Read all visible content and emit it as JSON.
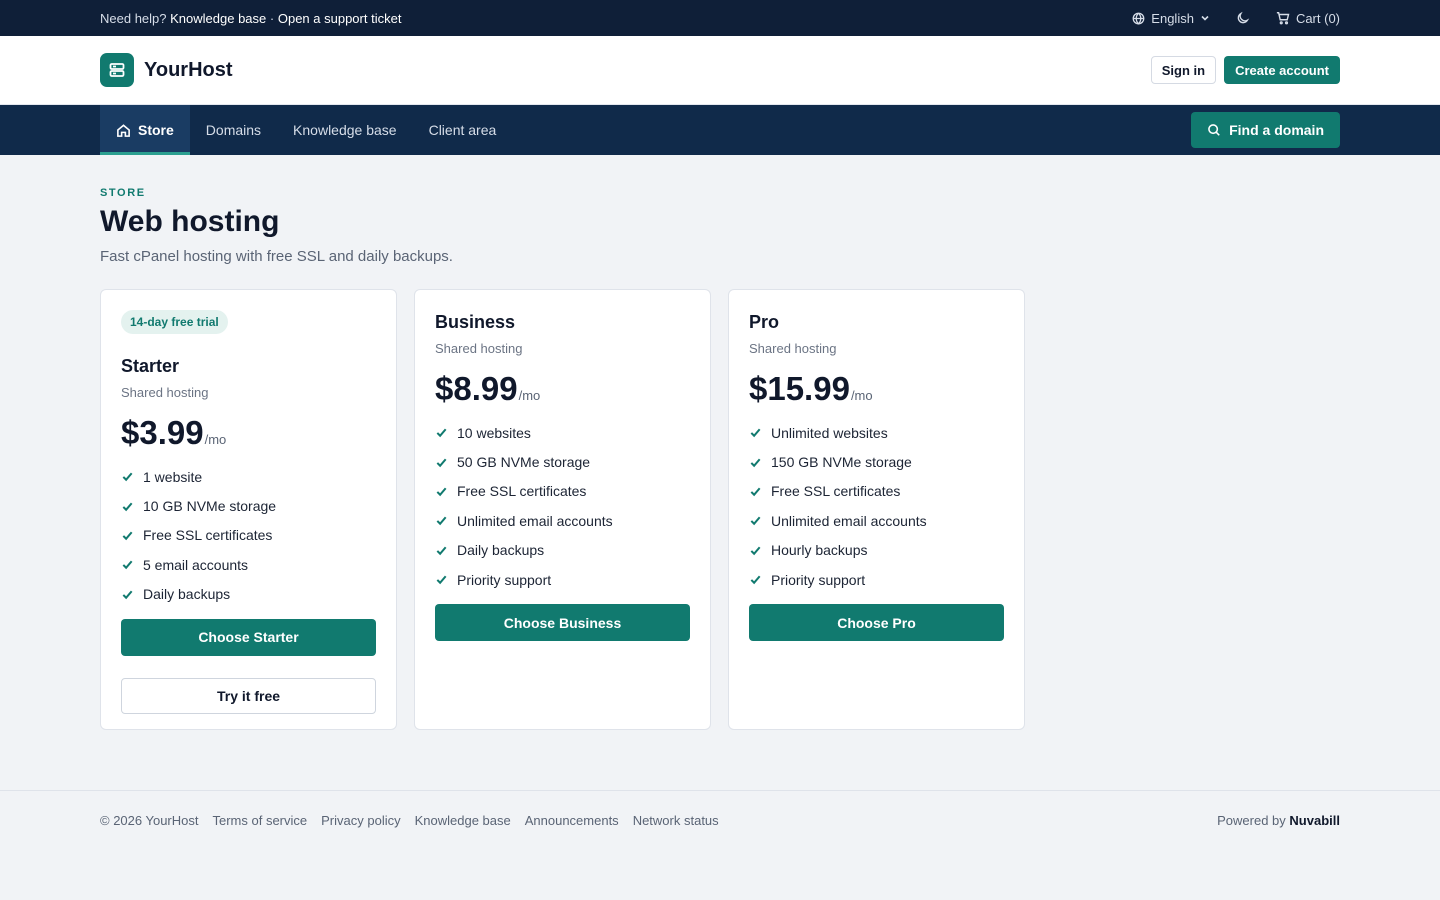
{
  "topbar": {
    "help_prefix": "Need help?",
    "kb_link": "Knowledge base",
    "separator": "·",
    "ticket_link": "Open a support ticket",
    "language": "English",
    "cart": "Cart (0)"
  },
  "header": {
    "brand": "YourHost",
    "sign_in": "Sign in",
    "create_account": "Create account"
  },
  "nav": {
    "items": [
      {
        "label": "Store",
        "active": true
      },
      {
        "label": "Domains"
      },
      {
        "label": "Knowledge base"
      },
      {
        "label": "Client area"
      }
    ],
    "find_domain": "Find a domain"
  },
  "page": {
    "eyebrow": "STORE",
    "title": "Web hosting",
    "subtitle": "Fast cPanel hosting with free SSL and daily backups."
  },
  "plans": [
    {
      "badge": "14-day free trial",
      "name": "Starter",
      "type": "Shared hosting",
      "price": "$3.99",
      "per": "/mo",
      "features": [
        "1 website",
        "10 GB NVMe storage",
        "Free SSL certificates",
        "5 email accounts",
        "Daily backups"
      ],
      "cta": "Choose Starter",
      "secondary": "Try it free"
    },
    {
      "name": "Business",
      "type": "Shared hosting",
      "price": "$8.99",
      "per": "/mo",
      "features": [
        "10 websites",
        "50 GB NVMe storage",
        "Free SSL certificates",
        "Unlimited email accounts",
        "Daily backups",
        "Priority support"
      ],
      "cta": "Choose Business"
    },
    {
      "name": "Pro",
      "type": "Shared hosting",
      "price": "$15.99",
      "per": "/mo",
      "features": [
        "Unlimited websites",
        "150 GB NVMe storage",
        "Free SSL certificates",
        "Unlimited email accounts",
        "Hourly backups",
        "Priority support"
      ],
      "cta": "Choose Pro"
    }
  ],
  "footer": {
    "copyright": "© 2026 YourHost",
    "links": [
      "Terms of service",
      "Privacy policy",
      "Knowledge base",
      "Announcements",
      "Network status"
    ],
    "powered_prefix": "Powered by",
    "powered_brand": "Nuvabill"
  },
  "colors": {
    "accent": "#117a6f",
    "topbar": "#0f1f38",
    "nav": "#102a4a"
  },
  "icons": {
    "logo": "server-icon",
    "language": "globe-icon",
    "theme": "moon-icon",
    "cart": "cart-icon",
    "store": "home-icon",
    "find": "search-icon",
    "feature": "check-icon"
  }
}
